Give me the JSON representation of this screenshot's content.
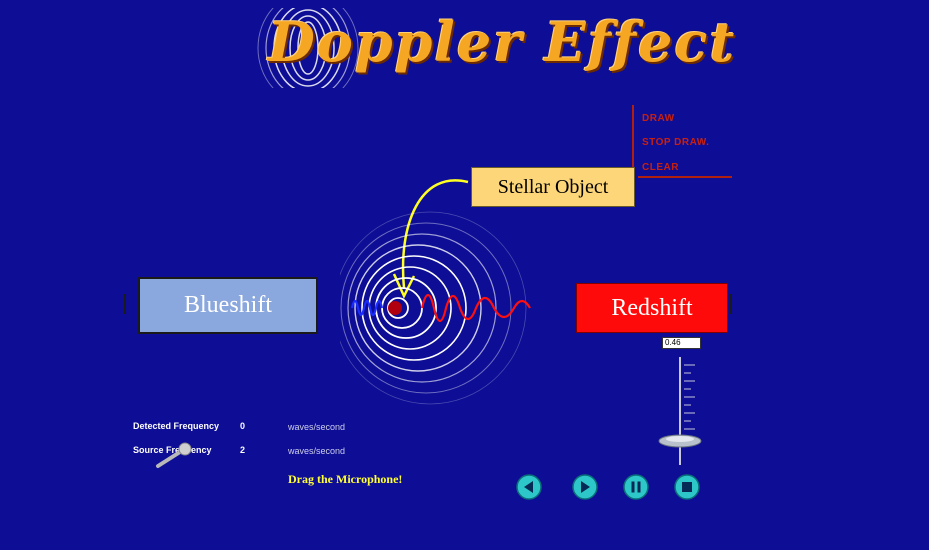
{
  "title": "Doppler Effect",
  "menu": {
    "draw": "DRAW",
    "stop_draw": "STOP DRAW.",
    "clear": "CLEAR"
  },
  "stellar_label": "Stellar Object",
  "blueshift_label": "Blueshift",
  "redshift_label": "Redshift",
  "speed_value": "0.46",
  "readouts": {
    "detected_label": "Detected Frequency",
    "detected_value": "0",
    "detected_unit": "waves/second",
    "source_label": "Source Frequency",
    "source_value": "2",
    "source_unit": "waves/second"
  },
  "drag_hint": "Drag the Microphone!",
  "controls": [
    "rewind",
    "play",
    "pause",
    "stop"
  ],
  "colors": {
    "background": "#0d0d96",
    "title": "#f5a623",
    "menu": "#c8200f",
    "blueshift": "#8aa7de",
    "redshift": "#ff0a0a",
    "label": "#fdd67a",
    "control_button": "#2ec7c9"
  }
}
